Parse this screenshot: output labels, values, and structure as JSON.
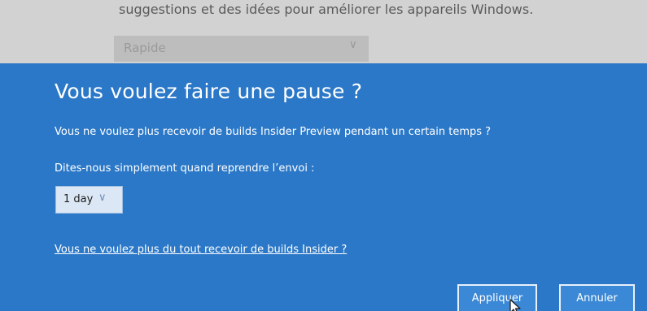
{
  "background": {
    "description_text": "suggestions et des idées pour améliorer les appareils Windows.",
    "select_value": "Rapide"
  },
  "dialog": {
    "title": "Vous voulez faire une pause ?",
    "question": "Vous ne voulez plus recevoir de builds Insider Preview pendant un certain temps ?",
    "instruction": "Dites-nous simplement quand reprendre l’envoi :",
    "duration_select": {
      "value": "1 day"
    },
    "stop_link": "Vous ne voulez plus du tout recevoir de builds Insider ?",
    "apply_label": "Appliquer",
    "cancel_label": "Annuler"
  },
  "colors": {
    "dialog_background": "#2b78c8",
    "text": "#ffffff"
  },
  "icons": {
    "select_chevron": "chevron-down-icon",
    "cursor": "mouse-pointer-icon"
  }
}
